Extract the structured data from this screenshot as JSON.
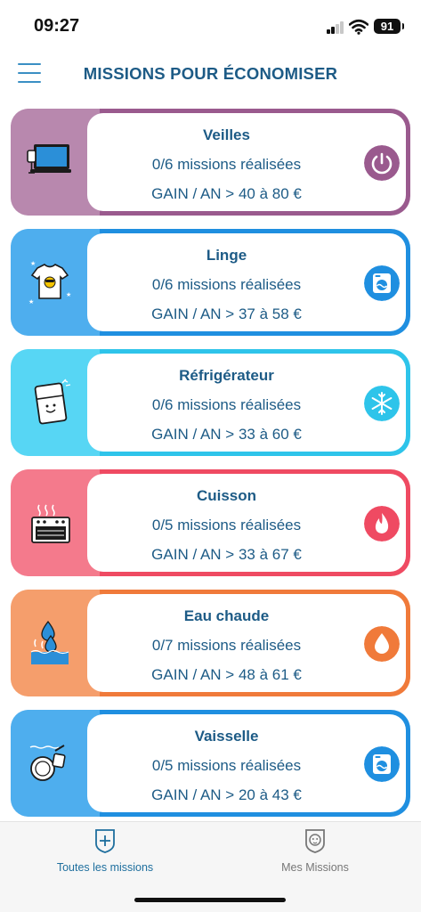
{
  "status_bar": {
    "time": "09:27",
    "battery": "91"
  },
  "header": {
    "title": "MISSIONS POUR ÉCONOMISER",
    "menu_icon": "hamburger-menu-icon"
  },
  "cards": [
    {
      "title": "Veilles",
      "progress": "0/6 missions réalisées",
      "gain": "GAIN / AN > 40 à 80 €",
      "color": "#9a5a8e",
      "light": "#b888ae",
      "badge_icon": "power-icon",
      "illustration": "computer-illustration"
    },
    {
      "title": "Linge",
      "progress": "0/6 missions réalisées",
      "gain": "GAIN / AN > 37 à 58 €",
      "color": "#1f8fe0",
      "light": "#4eaeee",
      "badge_icon": "washing-machine-icon",
      "illustration": "tshirt-illustration"
    },
    {
      "title": "Réfrigérateur",
      "progress": "0/6 missions réalisées",
      "gain": "GAIN / AN > 33 à 60 €",
      "color": "#2ec4ea",
      "light": "#57d6f4",
      "badge_icon": "snowflake-icon",
      "illustration": "fridge-illustration"
    },
    {
      "title": "Cuisson",
      "progress": "0/5 missions réalisées",
      "gain": "GAIN / AN > 33 à 67 €",
      "color": "#ef4a62",
      "light": "#f47a8c",
      "badge_icon": "flame-icon",
      "illustration": "oven-illustration"
    },
    {
      "title": "Eau chaude",
      "progress": "0/7 missions réalisées",
      "gain": "GAIN / AN > 48 à 61 €",
      "color": "#f07a3a",
      "light": "#f59e6c",
      "badge_icon": "water-drop-icon",
      "illustration": "water-drops-illustration"
    },
    {
      "title": "Vaisselle",
      "progress": "0/5 missions réalisées",
      "gain": "GAIN / AN > 20 à 43 €",
      "color": "#1f8fe0",
      "light": "#4eaeee",
      "badge_icon": "dishwasher-icon",
      "illustration": "dishes-illustration"
    }
  ],
  "tabbar": {
    "tabs": [
      {
        "label": "Toutes les missions",
        "icon": "shield-plus-icon",
        "active": true
      },
      {
        "label": "Mes Missions",
        "icon": "monkey-shield-icon",
        "active": false
      }
    ],
    "active_color": "#1f6f9e",
    "inactive_color": "#777777"
  }
}
